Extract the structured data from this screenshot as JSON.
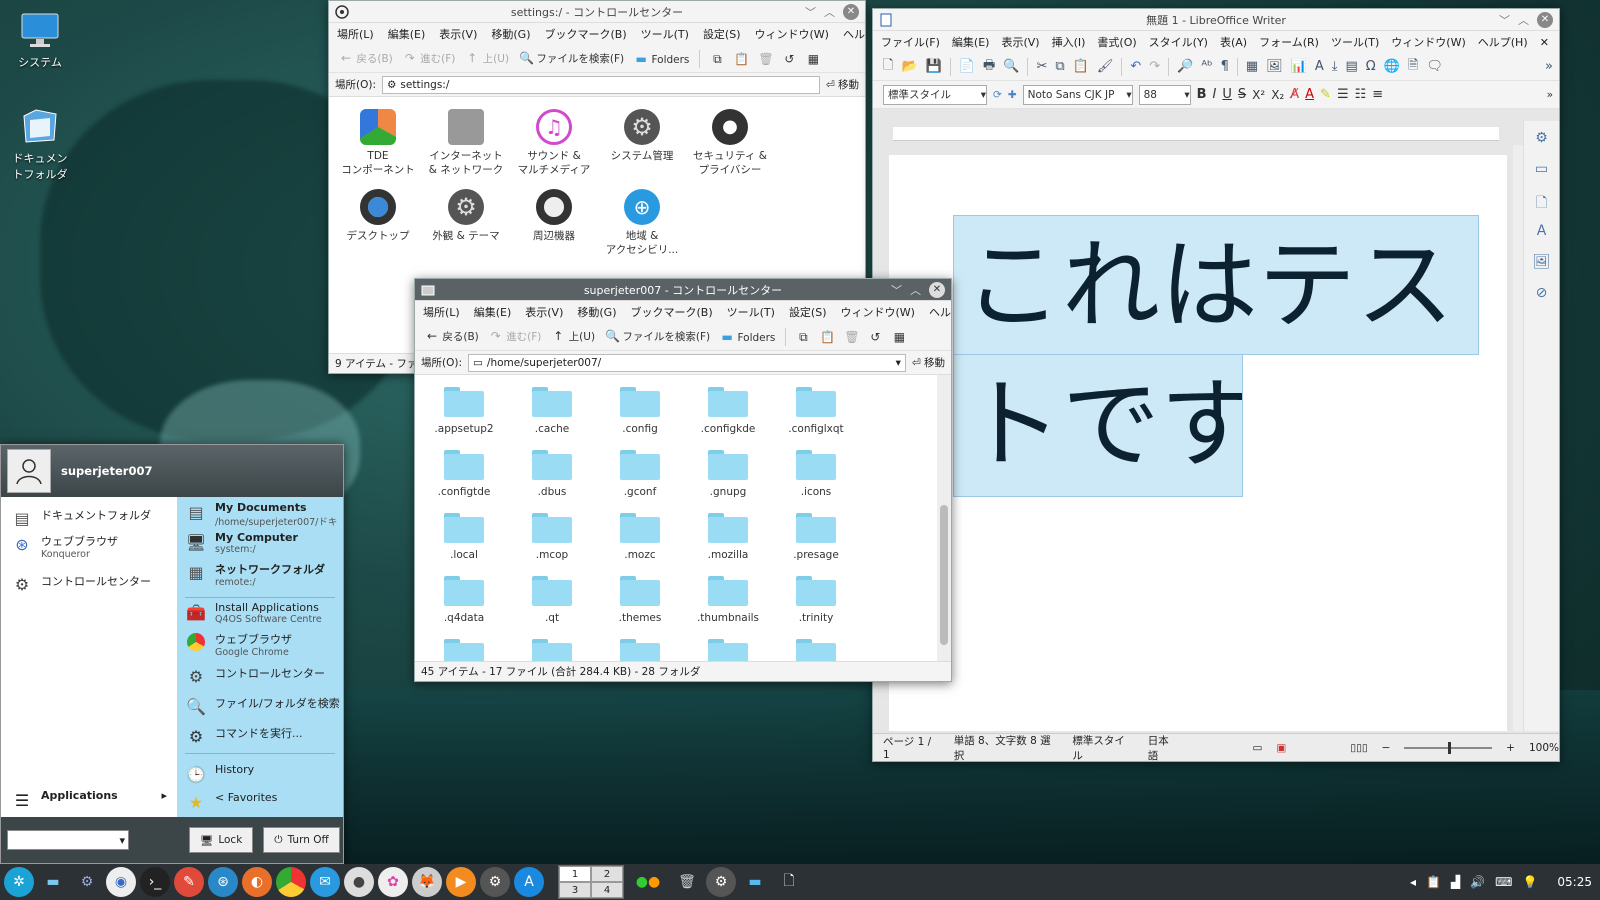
{
  "desktop": {
    "icons": [
      {
        "label": "システム"
      },
      {
        "label": "ドキュメン\nトフォルダ"
      }
    ]
  },
  "settings_window": {
    "title": "settings:/ - コントロールセンター",
    "menu": [
      "場所(L)",
      "編集(E)",
      "表示(V)",
      "移動(G)",
      "ブックマーク(B)",
      "ツール(T)",
      "設定(S)",
      "ウィンドウ(W)",
      "ヘルプ(H)"
    ],
    "toolbar": {
      "back": "戻る(B)",
      "forward": "進む(F)",
      "up": "上(U)",
      "search": "ファイルを検索(F)",
      "folders": "Folders"
    },
    "location_label": "場所(O):",
    "location_value": "settings:/",
    "go_label": "移動",
    "items": [
      {
        "label": "TDE\nコンポーネント"
      },
      {
        "label": "インターネット\n& ネットワーク"
      },
      {
        "label": "サウンド &\nマルチメディア"
      },
      {
        "label": "システム管理"
      },
      {
        "label": "セキュリティ &\nプライバシー"
      },
      {
        "label": "デスクトップ"
      },
      {
        "label": "外観 & テーマ"
      },
      {
        "label": "周辺機器"
      },
      {
        "label": "地域 &\nアクセシビリ..."
      }
    ],
    "status": "9 アイテム - ファ"
  },
  "home_window": {
    "title": "superjeter007 - コントロールセンター",
    "menu": [
      "場所(L)",
      "編集(E)",
      "表示(V)",
      "移動(G)",
      "ブックマーク(B)",
      "ツール(T)",
      "設定(S)",
      "ウィンドウ(W)",
      "ヘルプ(H)"
    ],
    "toolbar": {
      "back": "戻る(B)",
      "forward": "進む(F)",
      "up": "上(U)",
      "search": "ファイルを検索(F)",
      "folders": "Folders"
    },
    "location_label": "場所(O):",
    "location_value": "/home/superjeter007/",
    "go_label": "移動",
    "folders": [
      ".appsetup2",
      ".cache",
      ".config",
      ".configkde",
      ".configlxqt",
      ".configtde",
      ".dbus",
      ".gconf",
      ".gnupg",
      ".icons",
      ".local",
      ".mcop",
      ".mozc",
      ".mozilla",
      ".presage",
      ".q4data",
      ".qt",
      ".themes",
      ".thumbnails",
      ".trinity"
    ],
    "status": "45 アイテム - 17 ファイル (合計 284.4 KB) - 28 フォルダ"
  },
  "writer": {
    "title": "無題 1 - LibreOffice Writer",
    "menu": [
      "ファイル(F)",
      "編集(E)",
      "表示(V)",
      "挿入(I)",
      "書式(O)",
      "スタイル(Y)",
      "表(A)",
      "フォーム(R)",
      "ツール(T)",
      "ウィンドウ(W)",
      "ヘルプ(H)"
    ],
    "para_style": "標準スタイル",
    "font_name": "Noto Sans CJK JP",
    "font_size": "88",
    "text_line1": "これはテス",
    "text_line2": "トです",
    "status": {
      "page": "ページ 1 / 1",
      "words": "単語 8、文字数 8 選択",
      "style": "標準スタイル",
      "lang": "日本語",
      "zoom": "100%"
    }
  },
  "start_menu": {
    "user": "superjeter007",
    "left_items": [
      {
        "label": "ドキュメントフォルダ",
        "sub": ""
      },
      {
        "label": "ウェブブラウザ",
        "sub": "Konqueror"
      },
      {
        "label": "コントロールセンター",
        "sub": ""
      }
    ],
    "right_items": [
      {
        "label": "My Documents",
        "sub": "/home/superjeter007/ドキ"
      },
      {
        "label": "My Computer",
        "sub": "system:/"
      },
      {
        "label": "ネットワークフォルダ",
        "sub": "remote:/"
      },
      {
        "label": "Install Applications",
        "sub": "Q4OS Software Centre"
      },
      {
        "label": "ウェブブラウザ",
        "sub": "Google Chrome"
      },
      {
        "label": "コントロールセンター",
        "sub": ""
      },
      {
        "label": "ファイル/フォルダを検索",
        "sub": ""
      },
      {
        "label": "コマンドを実行...",
        "sub": ""
      },
      {
        "label": "History",
        "sub": ""
      },
      {
        "label": "< Favorites",
        "sub": ""
      }
    ],
    "applications_label": "Applications",
    "lock_label": "Lock",
    "turnoff_label": "Turn Off"
  },
  "taskbar": {
    "pager": [
      "1",
      "2",
      "3",
      "4"
    ],
    "clock": "05:25"
  },
  "colors": {
    "accent": "#a9def5",
    "folder": "#9adcf3",
    "selection": "#cde8f6"
  }
}
